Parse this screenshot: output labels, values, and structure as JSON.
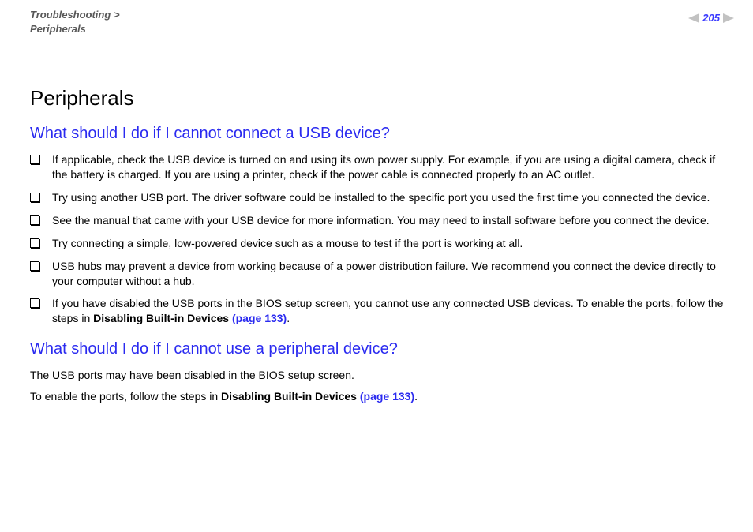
{
  "header": {
    "breadcrumb_section": "Troubleshooting",
    "separator": ">",
    "breadcrumb_page": "Peripherals",
    "page_number": "205"
  },
  "title": "Peripherals",
  "section1": {
    "heading": "What should I do if I cannot connect a USB device?",
    "bullets": [
      "If applicable, check the USB device is turned on and using its own power supply. For example, if you are using a digital camera, check if the battery is charged. If you are using a printer, check if the power cable is connected properly to an AC outlet.",
      "Try using another USB port. The driver software could be installed to the specific port you used the first time you connected the device.",
      "See the manual that came with your USB device for more information. You may need to install software before you connect the device.",
      "Try connecting a simple, low-powered device such as a mouse to test if the port is working at all.",
      "USB hubs may prevent a device from working because of a power distribution failure. We recommend you connect the device directly to your computer without a hub."
    ],
    "bullet6_pre": "If you have disabled the USB ports in the BIOS setup screen, you cannot use any connected USB devices. To enable the ports, follow the steps in ",
    "bullet6_bold": "Disabling Built-in Devices",
    "bullet6_link": "(page 133)",
    "bullet6_post": "."
  },
  "section2": {
    "heading": "What should I do if I cannot use a peripheral device?",
    "para1": "The USB ports may have been disabled in the BIOS setup screen.",
    "para2_pre": "To enable the ports, follow the steps in ",
    "para2_bold": "Disabling Built-in Devices",
    "para2_link": "(page 133)",
    "para2_post": "."
  }
}
